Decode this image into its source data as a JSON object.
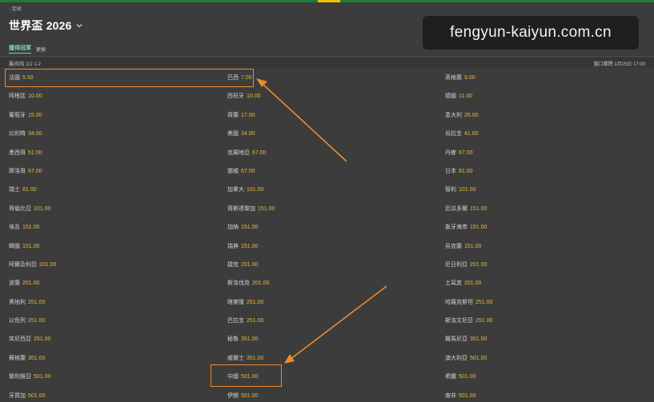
{
  "breadcrumb": "· 足球",
  "title": "世界盃 2026",
  "watermark": "fengyun-kaiyun.com.cn",
  "subnav": {
    "active": "獲得冠軍",
    "other": "更換"
  },
  "info": {
    "left": "贏/前段 1/2 1-2",
    "right": "盤口關閉 1月25日 17:00"
  },
  "colors": {
    "odds": "#e9b93f",
    "highlight": "#f08a2c",
    "accent_green": "#1f7a3a"
  },
  "rows": [
    [
      {
        "team": "法國",
        "odds": "5.50"
      },
      {
        "team": "巴西",
        "odds": "7.00"
      },
      {
        "team": "英格蘭",
        "odds": "9.00"
      }
    ],
    [
      {
        "team": "阿根廷",
        "odds": "10.00"
      },
      {
        "team": "西班牙",
        "odds": "10.00"
      },
      {
        "team": "德國",
        "odds": "11.00"
      }
    ],
    [
      {
        "team": "葡萄牙",
        "odds": "15.00"
      },
      {
        "team": "荷蘭",
        "odds": "17.00"
      },
      {
        "team": "意大利",
        "odds": "26.00"
      }
    ],
    [
      {
        "team": "比利時",
        "odds": "34.00"
      },
      {
        "team": "美國",
        "odds": "34.00"
      },
      {
        "team": "烏拉圭",
        "odds": "41.00"
      }
    ],
    [
      {
        "team": "墨西哥",
        "odds": "51.00"
      },
      {
        "team": "克羅地亞",
        "odds": "67.00"
      },
      {
        "team": "丹麥",
        "odds": "67.00"
      }
    ],
    [
      {
        "team": "摩洛哥",
        "odds": "67.00"
      },
      {
        "team": "挪威",
        "odds": "67.00"
      },
      {
        "team": "日本",
        "odds": "81.00"
      }
    ],
    [
      {
        "team": "瑞士",
        "odds": "81.00"
      },
      {
        "team": "加拿大",
        "odds": "101.00"
      },
      {
        "team": "智利",
        "odds": "101.00"
      }
    ],
    [
      {
        "team": "哥倫比亞",
        "odds": "101.00"
      },
      {
        "team": "哥斯達黎加",
        "odds": "151.00"
      },
      {
        "team": "厄瓜多爾",
        "odds": "151.00"
      }
    ],
    [
      {
        "team": "埃及",
        "odds": "151.00"
      },
      {
        "team": "加納",
        "odds": "151.00"
      },
      {
        "team": "象牙海岸",
        "odds": "151.00"
      }
    ],
    [
      {
        "team": "韓國",
        "odds": "151.00"
      },
      {
        "team": "瑞典",
        "odds": "151.00"
      },
      {
        "team": "烏克蘭",
        "odds": "151.00"
      }
    ],
    [
      {
        "team": "阿爾及利亞",
        "odds": "201.00"
      },
      {
        "team": "捷克",
        "odds": "201.00"
      },
      {
        "team": "尼日利亞",
        "odds": "201.00"
      }
    ],
    [
      {
        "team": "波蘭",
        "odds": "201.00"
      },
      {
        "team": "斯洛伐克",
        "odds": "201.00"
      },
      {
        "team": "土耳其",
        "odds": "201.00"
      }
    ],
    [
      {
        "team": "奧地利",
        "odds": "251.00"
      },
      {
        "team": "喀麥隆",
        "odds": "251.00"
      },
      {
        "team": "哈薩克斯坦",
        "odds": "251.00"
      }
    ],
    [
      {
        "team": "以色列",
        "odds": "251.00"
      },
      {
        "team": "巴拉圭",
        "odds": "251.00"
      },
      {
        "team": "斯洛文尼亞",
        "odds": "251.00"
      }
    ],
    [
      {
        "team": "突尼西亞",
        "odds": "251.00"
      },
      {
        "team": "秘魯",
        "odds": "351.00"
      },
      {
        "team": "羅馬尼亞",
        "odds": "351.00"
      }
    ],
    [
      {
        "team": "蘇格蘭",
        "odds": "351.00"
      },
      {
        "team": "威爾士",
        "odds": "351.00"
      },
      {
        "team": "澳大利亞",
        "odds": "501.00"
      }
    ],
    [
      {
        "team": "玻利維亞",
        "odds": "501.00"
      },
      {
        "team": "中國",
        "odds": "501.00"
      },
      {
        "team": "希臘",
        "odds": "501.00"
      }
    ],
    [
      {
        "team": "牙買加",
        "odds": "501.00"
      },
      {
        "team": "伊朗",
        "odds": "501.00"
      },
      {
        "team": "南非",
        "odds": "501.00"
      }
    ]
  ]
}
